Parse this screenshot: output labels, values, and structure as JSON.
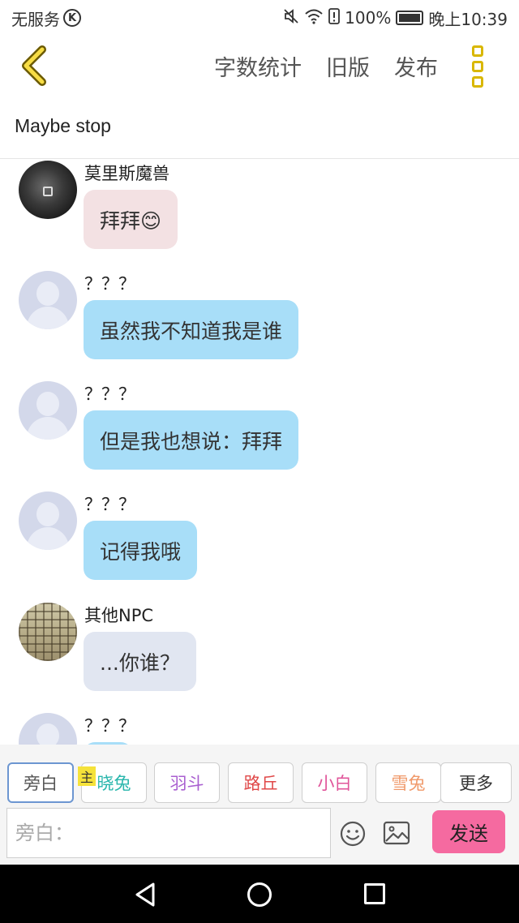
{
  "status_bar": {
    "carrier": "无服务",
    "carrier_icon": "K",
    "battery": "100%",
    "time": "晚上10:39",
    "icons": [
      "mute-icon",
      "wifi-icon",
      "alert-icon",
      "battery-icon"
    ]
  },
  "toolbar": {
    "back_icon": "chevron-left-icon",
    "actions": [
      "字数统计",
      "旧版",
      "发布"
    ],
    "menu_icon": "menu-dots-icon",
    "accent_color": "#d9b700"
  },
  "chat": {
    "title": "Maybe stop",
    "messages": [
      {
        "name": "莫里斯魔兽",
        "text": "拜拜😊",
        "style": "pink",
        "avatar": "dark"
      },
      {
        "name": "？？？",
        "text": "虽然我不知道我是谁",
        "style": "blue",
        "avatar": "default"
      },
      {
        "name": "？？？",
        "text": "但是我也想说：拜拜",
        "style": "blue",
        "avatar": "default"
      },
      {
        "name": "？？？",
        "text": "记得我哦",
        "style": "blue",
        "avatar": "default"
      },
      {
        "name": "其他NPC",
        "text": "...你谁？",
        "style": "gray",
        "avatar": "net"
      },
      {
        "name": "？？？",
        "text": "",
        "style": "blue",
        "avatar": "default"
      }
    ]
  },
  "roles": [
    {
      "label": "旁白",
      "color": "#555555",
      "selected": true
    },
    {
      "label": "晓兔",
      "color": "#29b6ac",
      "selected": false,
      "tag": "主"
    },
    {
      "label": "羽斗",
      "color": "#a95fd0",
      "selected": false
    },
    {
      "label": "路丘",
      "color": "#e04848",
      "selected": false
    },
    {
      "label": "小白",
      "color": "#e0559a",
      "selected": false
    },
    {
      "label": "雪兔",
      "color": "#f0996a",
      "selected": false
    },
    {
      "label": "更多",
      "color": "#333333",
      "selected": false
    }
  ],
  "composer": {
    "placeholder": "旁白：",
    "send_label": "发送",
    "emoji_icon": "emoji-icon",
    "image_icon": "image-icon",
    "send_color": "#f56aa0"
  },
  "nav_bar": {
    "icons": [
      "nav-back-icon",
      "nav-home-icon",
      "nav-recent-icon"
    ]
  }
}
